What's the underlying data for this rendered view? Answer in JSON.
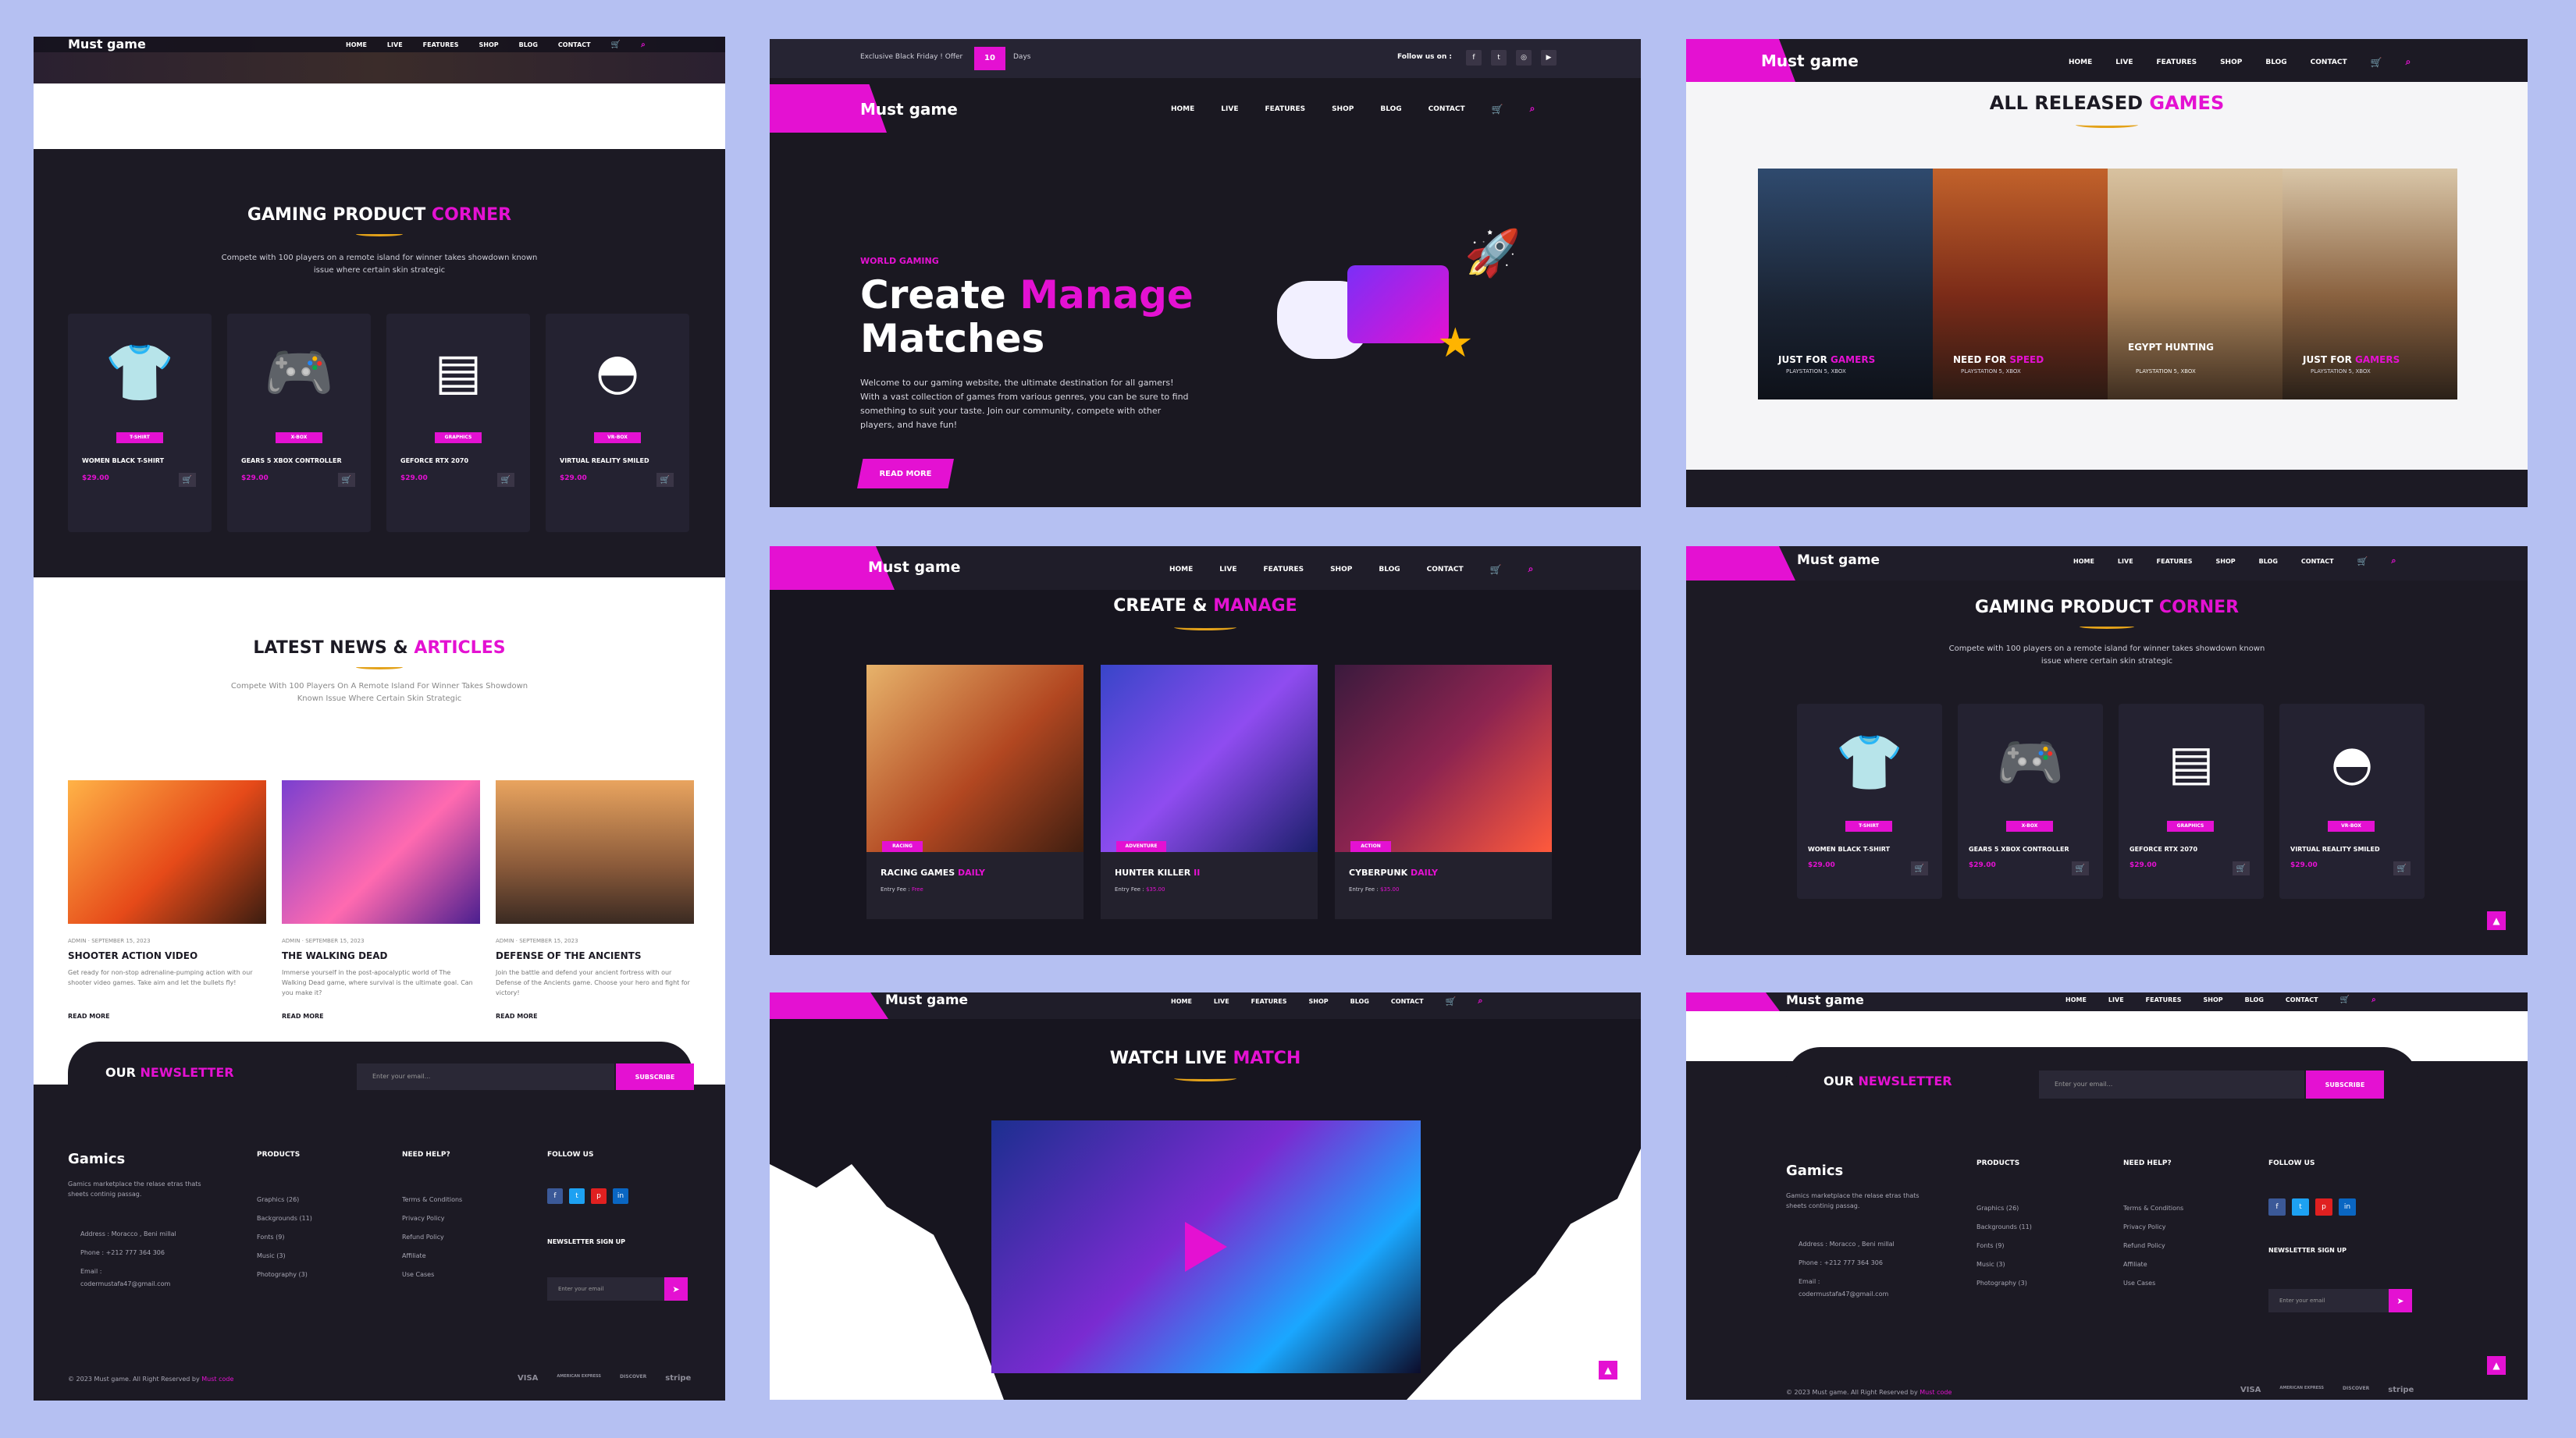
{
  "brand": {
    "name": "Must game",
    "footer_brand": "Gamics",
    "accent": "#e411d2",
    "gold": "#e3a21a",
    "dark": "#1c1a24"
  },
  "nav": {
    "items": [
      "HOME",
      "LIVE",
      "FEATURES",
      "SHOP",
      "BLOG",
      "CONTACT"
    ],
    "cart_count": "0"
  },
  "topbar": {
    "offer_text": "Exclusive Black Friday ! Offer",
    "offer_days": "10",
    "days_label": "Days",
    "follow_label": "Follow us on :"
  },
  "hero": {
    "kicker": "WORLD GAMING",
    "title_a": "Create",
    "title_b": "Manage",
    "title_c": "Matches",
    "body": "Welcome to our gaming website, the ultimate destination for all gamers! With a vast collection of games from various genres, you can be sure to find something to suit your taste. Join our community, compete with other players, and have fun!",
    "button": "READ MORE"
  },
  "released": {
    "title_a": "ALL RELEASED",
    "title_b": "GAMES",
    "items": [
      {
        "a": "JUST FOR",
        "b": "GAMERS",
        "platform": "PLAYSTATION 5, XBOX"
      },
      {
        "a": "NEED FOR",
        "b": "SPEED",
        "platform": "PLAYSTATION 5, XBOX"
      },
      {
        "a": "EGYPT HUNTING",
        "b": "",
        "platform": "PLAYSTATION 5, XBOX"
      },
      {
        "a": "JUST FOR",
        "b": "GAMERS",
        "platform": "PLAYSTATION 5, XBOX"
      }
    ]
  },
  "manage": {
    "title_a": "CREATE &",
    "title_b": "MANAGE",
    "items": [
      {
        "tag": "RACING",
        "a": "RACING GAMES",
        "b": "DAILY",
        "fee_label": "Entry Fee :",
        "fee": "Free"
      },
      {
        "tag": "ADVENTURE",
        "a": "HUNTER KILLER",
        "b": "II",
        "fee_label": "Entry Fee :",
        "fee": "$35.00"
      },
      {
        "tag": "ACTION",
        "a": "CYBERPUNK",
        "b": "DAILY",
        "fee_label": "Entry Fee :",
        "fee": "$35.00"
      }
    ]
  },
  "products": {
    "title_a": "GAMING PRODUCT",
    "title_b": "CORNER",
    "subtitle": "Compete with 100 players on a remote island for winner takes showdown known issue where certain skin strategic",
    "items": [
      {
        "badge": "T-SHIRT",
        "name": "WOMEN BLACK T-SHIRT",
        "price": "$29.00"
      },
      {
        "badge": "X-BOX",
        "name": "GEARS 5 XBOX CONTROLLER",
        "price": "$29.00"
      },
      {
        "badge": "GRAPHICS",
        "name": "GEFORCE RTX 2070",
        "price": "$29.00"
      },
      {
        "badge": "VR-BOX",
        "name": "VIRTUAL REALITY SMILED",
        "price": "$29.00"
      }
    ]
  },
  "live": {
    "title_a": "WATCH LIVE",
    "title_b": "MATCH"
  },
  "news": {
    "title_a": "LATEST NEWS &",
    "title_b": "ARTICLES",
    "subtitle": "Compete With 100 Players On A Remote Island For Winner Takes Showdown Known Issue Where Certain Skin Strategic",
    "items": [
      {
        "author": "ADMIN",
        "date": "SEPTEMBER 15, 2023",
        "title": "SHOOTER ACTION VIDEO",
        "body": "Get ready for non-stop adrenaline-pumping action with our shooter video games. Take aim and let the bullets fly!",
        "more": "READ MORE"
      },
      {
        "author": "ADMIN",
        "date": "SEPTEMBER 15, 2023",
        "title": "THE WALKING DEAD",
        "body": "Immerse yourself in the post-apocalyptic world of The Walking Dead game, where survival is the ultimate goal. Can you make it?",
        "more": "READ MORE"
      },
      {
        "author": "ADMIN",
        "date": "SEPTEMBER 15, 2023",
        "title": "DEFENSE OF THE ANCIENTS",
        "body": "Join the battle and defend your ancient fortress with our Defense of the Ancients game. Choose your hero and fight for victory!",
        "more": "READ MORE"
      }
    ]
  },
  "newsletter": {
    "title_a": "OUR",
    "title_b": "NEWSLETTER",
    "placeholder": "Enter your email...",
    "button": "SUBSCRIBE"
  },
  "footer": {
    "about": "Gamics marketplace the relase etras thats sheets continig passag.",
    "address": "Address : Moracco , Beni millal",
    "phone": "Phone : +212 777 364 306",
    "email_label": "Email :",
    "email": "codermustafa47@gmail.com",
    "col1_title": "PRODUCTS",
    "col1": [
      "Graphics (26)",
      "Backgrounds (11)",
      "Fonts (9)",
      "Music (3)",
      "Photography (3)"
    ],
    "col2_title": "NEED HELP?",
    "col2": [
      "Terms & Conditions",
      "Privacy Policy",
      "Refund Policy",
      "Affiliate",
      "Use Cases"
    ],
    "col3_title": "FOLLOW US",
    "signup_title": "NEWSLETTER SIGN UP",
    "signup_placeholder": "Enter your email",
    "copyright_a": "© 2023 Must game. All Right Reserved by",
    "copyright_b": "Must code",
    "pay": [
      "VISA",
      "AMERICAN EXPRESS",
      "DISCOVER",
      "stripe"
    ]
  }
}
